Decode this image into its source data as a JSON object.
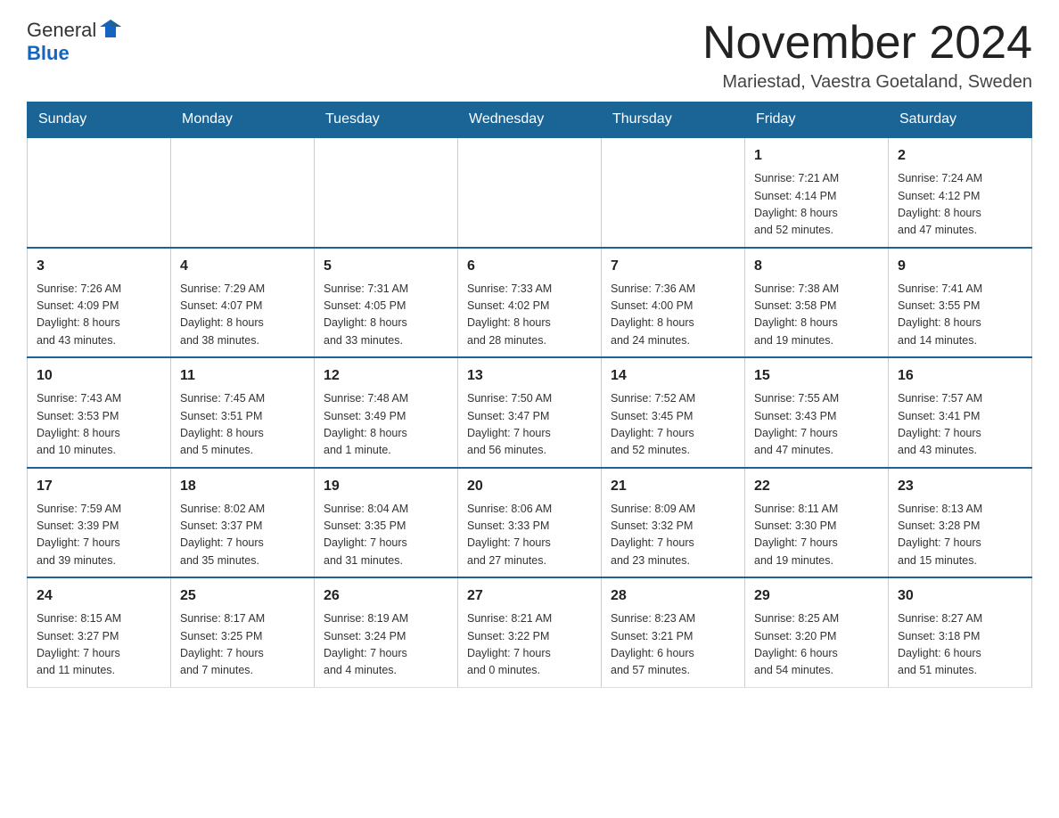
{
  "logo": {
    "text_general": "General",
    "text_blue": "Blue",
    "alt": "GeneralBlue logo"
  },
  "header": {
    "month_year": "November 2024",
    "location": "Mariestad, Vaestra Goetaland, Sweden"
  },
  "weekdays": [
    "Sunday",
    "Monday",
    "Tuesday",
    "Wednesday",
    "Thursday",
    "Friday",
    "Saturday"
  ],
  "weeks": [
    {
      "days": [
        {
          "num": "",
          "info": ""
        },
        {
          "num": "",
          "info": ""
        },
        {
          "num": "",
          "info": ""
        },
        {
          "num": "",
          "info": ""
        },
        {
          "num": "",
          "info": ""
        },
        {
          "num": "1",
          "info": "Sunrise: 7:21 AM\nSunset: 4:14 PM\nDaylight: 8 hours\nand 52 minutes."
        },
        {
          "num": "2",
          "info": "Sunrise: 7:24 AM\nSunset: 4:12 PM\nDaylight: 8 hours\nand 47 minutes."
        }
      ]
    },
    {
      "days": [
        {
          "num": "3",
          "info": "Sunrise: 7:26 AM\nSunset: 4:09 PM\nDaylight: 8 hours\nand 43 minutes."
        },
        {
          "num": "4",
          "info": "Sunrise: 7:29 AM\nSunset: 4:07 PM\nDaylight: 8 hours\nand 38 minutes."
        },
        {
          "num": "5",
          "info": "Sunrise: 7:31 AM\nSunset: 4:05 PM\nDaylight: 8 hours\nand 33 minutes."
        },
        {
          "num": "6",
          "info": "Sunrise: 7:33 AM\nSunset: 4:02 PM\nDaylight: 8 hours\nand 28 minutes."
        },
        {
          "num": "7",
          "info": "Sunrise: 7:36 AM\nSunset: 4:00 PM\nDaylight: 8 hours\nand 24 minutes."
        },
        {
          "num": "8",
          "info": "Sunrise: 7:38 AM\nSunset: 3:58 PM\nDaylight: 8 hours\nand 19 minutes."
        },
        {
          "num": "9",
          "info": "Sunrise: 7:41 AM\nSunset: 3:55 PM\nDaylight: 8 hours\nand 14 minutes."
        }
      ]
    },
    {
      "days": [
        {
          "num": "10",
          "info": "Sunrise: 7:43 AM\nSunset: 3:53 PM\nDaylight: 8 hours\nand 10 minutes."
        },
        {
          "num": "11",
          "info": "Sunrise: 7:45 AM\nSunset: 3:51 PM\nDaylight: 8 hours\nand 5 minutes."
        },
        {
          "num": "12",
          "info": "Sunrise: 7:48 AM\nSunset: 3:49 PM\nDaylight: 8 hours\nand 1 minute."
        },
        {
          "num": "13",
          "info": "Sunrise: 7:50 AM\nSunset: 3:47 PM\nDaylight: 7 hours\nand 56 minutes."
        },
        {
          "num": "14",
          "info": "Sunrise: 7:52 AM\nSunset: 3:45 PM\nDaylight: 7 hours\nand 52 minutes."
        },
        {
          "num": "15",
          "info": "Sunrise: 7:55 AM\nSunset: 3:43 PM\nDaylight: 7 hours\nand 47 minutes."
        },
        {
          "num": "16",
          "info": "Sunrise: 7:57 AM\nSunset: 3:41 PM\nDaylight: 7 hours\nand 43 minutes."
        }
      ]
    },
    {
      "days": [
        {
          "num": "17",
          "info": "Sunrise: 7:59 AM\nSunset: 3:39 PM\nDaylight: 7 hours\nand 39 minutes."
        },
        {
          "num": "18",
          "info": "Sunrise: 8:02 AM\nSunset: 3:37 PM\nDaylight: 7 hours\nand 35 minutes."
        },
        {
          "num": "19",
          "info": "Sunrise: 8:04 AM\nSunset: 3:35 PM\nDaylight: 7 hours\nand 31 minutes."
        },
        {
          "num": "20",
          "info": "Sunrise: 8:06 AM\nSunset: 3:33 PM\nDaylight: 7 hours\nand 27 minutes."
        },
        {
          "num": "21",
          "info": "Sunrise: 8:09 AM\nSunset: 3:32 PM\nDaylight: 7 hours\nand 23 minutes."
        },
        {
          "num": "22",
          "info": "Sunrise: 8:11 AM\nSunset: 3:30 PM\nDaylight: 7 hours\nand 19 minutes."
        },
        {
          "num": "23",
          "info": "Sunrise: 8:13 AM\nSunset: 3:28 PM\nDaylight: 7 hours\nand 15 minutes."
        }
      ]
    },
    {
      "days": [
        {
          "num": "24",
          "info": "Sunrise: 8:15 AM\nSunset: 3:27 PM\nDaylight: 7 hours\nand 11 minutes."
        },
        {
          "num": "25",
          "info": "Sunrise: 8:17 AM\nSunset: 3:25 PM\nDaylight: 7 hours\nand 7 minutes."
        },
        {
          "num": "26",
          "info": "Sunrise: 8:19 AM\nSunset: 3:24 PM\nDaylight: 7 hours\nand 4 minutes."
        },
        {
          "num": "27",
          "info": "Sunrise: 8:21 AM\nSunset: 3:22 PM\nDaylight: 7 hours\nand 0 minutes."
        },
        {
          "num": "28",
          "info": "Sunrise: 8:23 AM\nSunset: 3:21 PM\nDaylight: 6 hours\nand 57 minutes."
        },
        {
          "num": "29",
          "info": "Sunrise: 8:25 AM\nSunset: 3:20 PM\nDaylight: 6 hours\nand 54 minutes."
        },
        {
          "num": "30",
          "info": "Sunrise: 8:27 AM\nSunset: 3:18 PM\nDaylight: 6 hours\nand 51 minutes."
        }
      ]
    }
  ]
}
